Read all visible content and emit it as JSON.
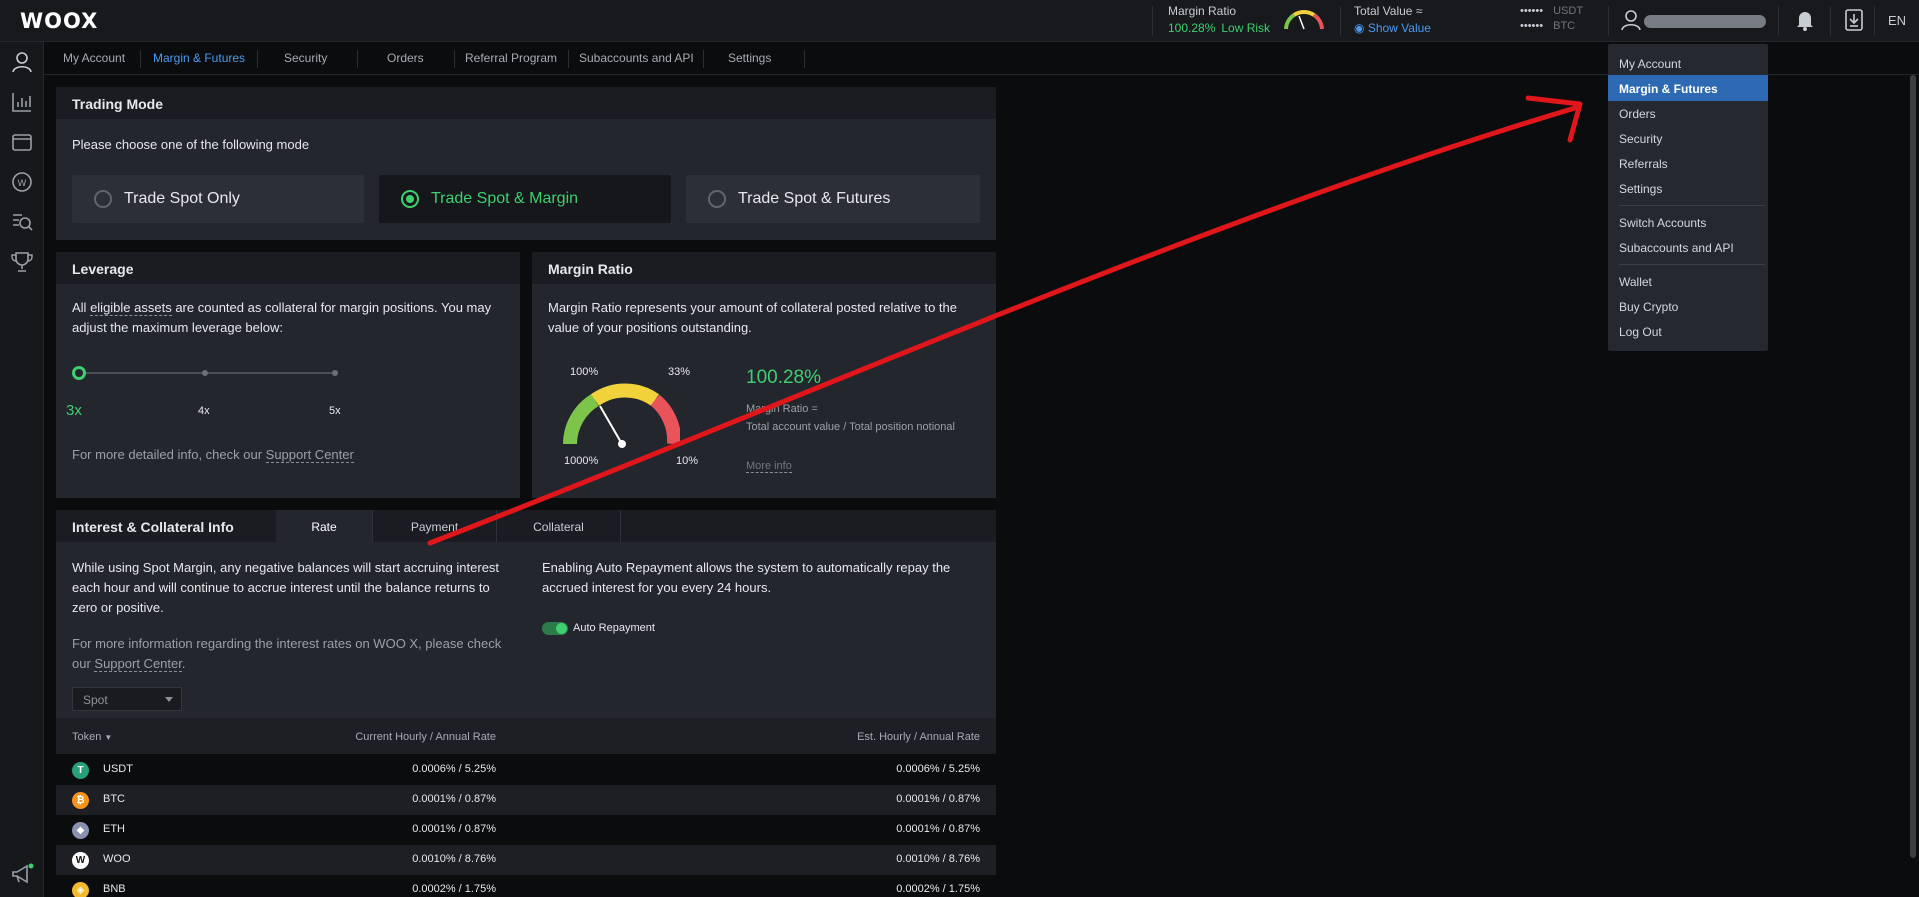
{
  "header": {
    "logo": "WOOX",
    "margin_ratio_label": "Margin Ratio",
    "margin_ratio_value": "100.28%",
    "risk_label": "Low Risk",
    "total_value_label": "Total Value ≈",
    "show_value": "Show Value",
    "balance_mask_1": "••••••",
    "balance_mask_2": "••••••",
    "currency_1": "USDT",
    "currency_2": "BTC",
    "language": "EN"
  },
  "subnav": {
    "tabs": [
      "My Account",
      "Margin & Futures",
      "Security",
      "Orders",
      "Referral Program",
      "Subaccounts and API",
      "Settings"
    ],
    "active": "Margin & Futures"
  },
  "trading_mode": {
    "title": "Trading Mode",
    "prompt": "Please choose one of the following mode",
    "options": [
      "Trade Spot Only",
      "Trade Spot & Margin",
      "Trade Spot & Futures"
    ],
    "selected": "Trade Spot & Margin"
  },
  "leverage": {
    "title": "Leverage",
    "text_before": "All ",
    "text_link": "eligible assets",
    "text_after": " are counted as collateral for margin positions. You may adjust the maximum leverage below:",
    "steps": [
      "3x",
      "4x",
      "5x"
    ],
    "current_step_fraction": 0,
    "footer_before": "For more detailed info, check our ",
    "footer_link": "Support Center"
  },
  "margin_ratio": {
    "title": "Margin Ratio",
    "description": "Margin Ratio represents your amount of collateral posted relative to the value of your positions outstanding.",
    "gauge_labels": {
      "top_left": "100%",
      "top_right": "33%",
      "bottom_left": "1000%",
      "bottom_right": "10%"
    },
    "value": "100.28%",
    "formula_title": "Margin Ratio =",
    "formula": "Total account value / Total position notional",
    "more_info": "More info",
    "colors": {
      "low": "#7cc44a",
      "mid": "#f2d23a",
      "high": "#e9545b",
      "value": "#3ecf6e"
    }
  },
  "interest": {
    "title": "Interest & Collateral Info",
    "tabs": [
      "Rate",
      "Payment",
      "Collateral"
    ],
    "active_tab": "Rate",
    "left_text": "While using Spot Margin, any negative balances will start accruing interest each hour and will continue to accrue interest until the balance returns to zero or positive.",
    "left_footer_before": "For more information regarding the interest rates on WOO X, please check our ",
    "left_footer_link": "Support Center",
    "left_footer_after": ".",
    "right_text": "Enabling Auto Repayment allows the system to automatically repay the accrued interest for you every 24 hours.",
    "auto_repayment_label": "Auto Repayment",
    "auto_repayment_on": true,
    "select_value": "Spot"
  },
  "rate_table": {
    "headers": [
      "Token",
      "Current Hourly / Annual Rate",
      "Est. Hourly / Annual Rate"
    ],
    "rows": [
      {
        "token": "USDT",
        "icon": "T",
        "color": "#26a17b",
        "current": "0.0006% / 5.25%",
        "est": "0.0006% / 5.25%"
      },
      {
        "token": "BTC",
        "icon": "₿",
        "color": "#f7931a",
        "current": "0.0001% / 0.87%",
        "est": "0.0001% / 0.87%"
      },
      {
        "token": "ETH",
        "icon": "◆",
        "color": "#8a92b2",
        "current": "0.0001% / 0.87%",
        "est": "0.0001% / 0.87%"
      },
      {
        "token": "WOO",
        "icon": "W",
        "color": "#ffffff",
        "current": "0.0010% / 8.76%",
        "est": "0.0010% / 8.76%"
      },
      {
        "token": "BNB",
        "icon": "◈",
        "color": "#f3ba2f",
        "current": "0.0002% / 1.75%",
        "est": "0.0002% / 1.75%"
      }
    ]
  },
  "user_menu": {
    "groups": [
      [
        "My Account",
        "Margin & Futures",
        "Orders",
        "Security",
        "Referrals",
        "Settings"
      ],
      [
        "Switch Accounts",
        "Subaccounts and API"
      ],
      [
        "Wallet",
        "Buy Crypto",
        "Log Out"
      ]
    ],
    "active": "Margin & Futures"
  },
  "annotation_color": "#e0161b"
}
